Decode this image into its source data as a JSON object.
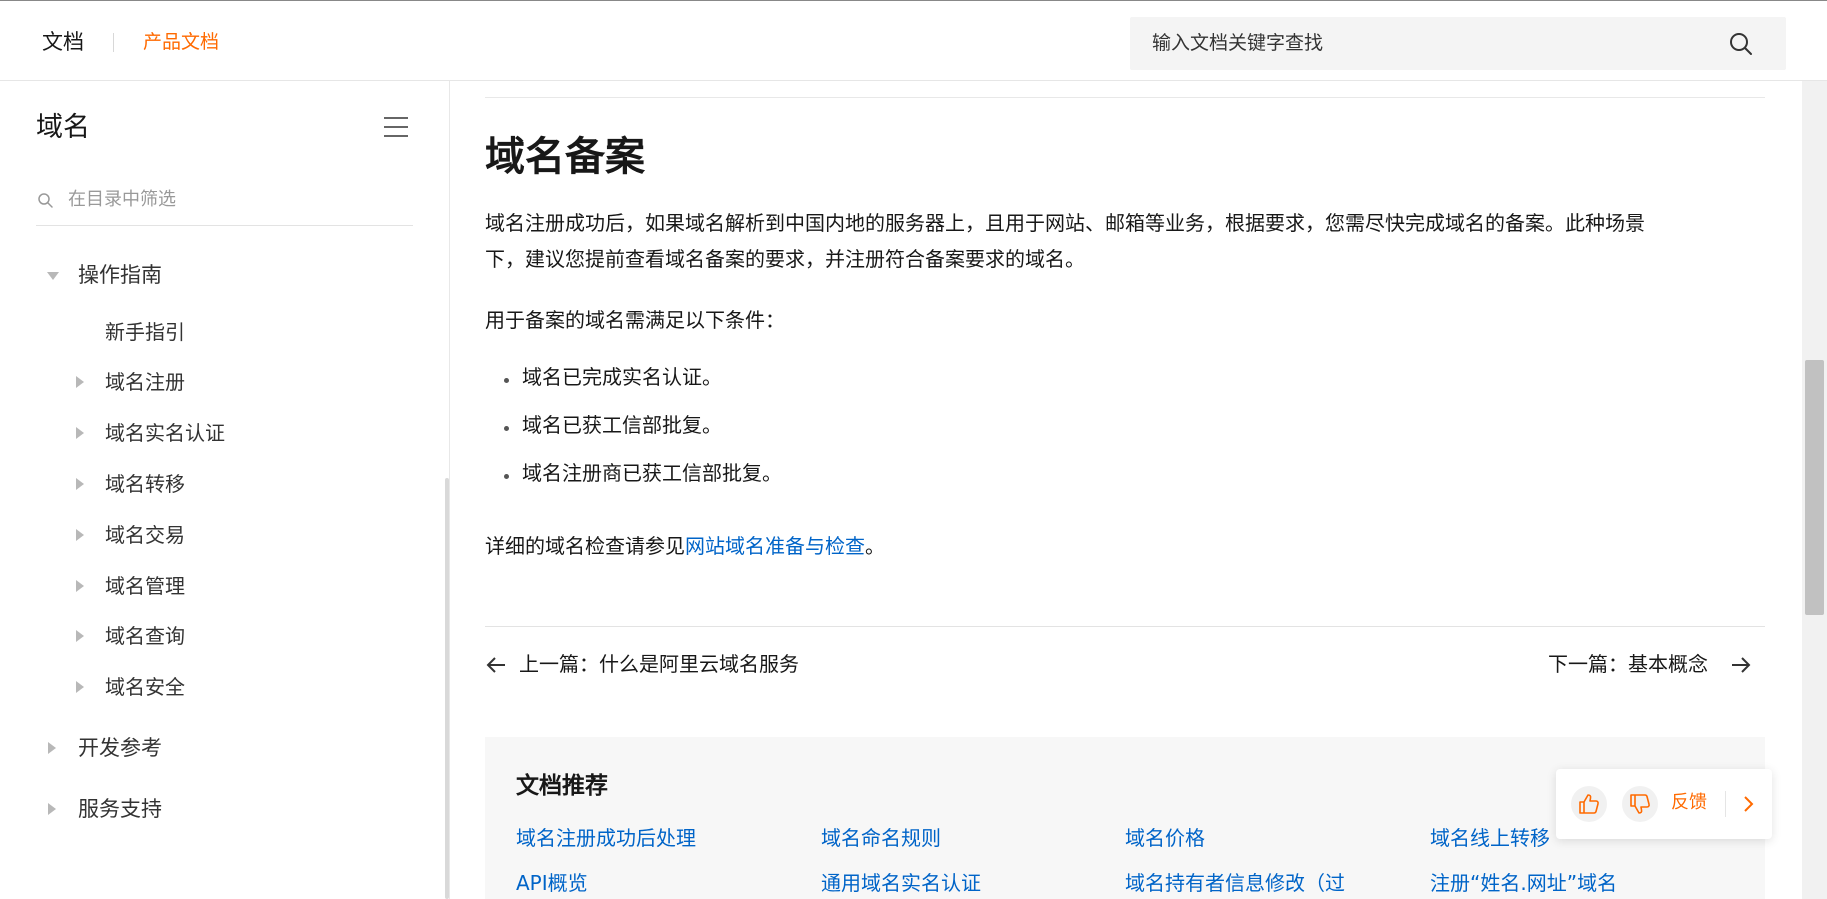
{
  "header": {
    "brand": "文档",
    "crumb": "产品文档",
    "search_placeholder": "输入文档关键字查找"
  },
  "sidebar": {
    "title": "域名",
    "filter_placeholder": "在目录中筛选",
    "groups": [
      {
        "label": "操作指南",
        "expanded": true,
        "children": [
          "新手指引",
          "域名注册",
          "域名实名认证",
          "域名转移",
          "域名交易",
          "域名管理",
          "域名查询",
          "域名安全"
        ]
      },
      {
        "label": "开发参考",
        "expanded": false
      },
      {
        "label": "服务支持",
        "expanded": false
      }
    ]
  },
  "article": {
    "title": "域名备案",
    "intro_line1": "域名注册成功后，如果域名解析到中国内地的服务器上，且用于网站、邮箱等业务，根据要求，您需尽快完成域名的备案。此种场景",
    "intro_line2": "下，建议您提前查看域名备案的要求，并注册符合备案要求的域名。",
    "conditions_lead": "用于备案的域名需满足以下条件：",
    "conditions": [
      "域名已完成实名认证。",
      "域名已获工信部批复。",
      "域名注册商已获工信部批复。"
    ],
    "detail_prefix": "详细的域名检查请参见",
    "detail_link": "网站域名准备与检查",
    "detail_suffix": "。"
  },
  "pagination": {
    "prev": "上一篇：什么是阿里云域名服务",
    "next": "下一篇：基本概念"
  },
  "recommend": {
    "title": "文档推荐",
    "row1": [
      "域名注册成功后处理",
      "域名命名规则",
      "域名价格",
      "域名线上转移"
    ],
    "row2": [
      "API概览",
      "通用域名实名认证",
      "域名持有者信息修改（过",
      "注册“姓名.网址”域名"
    ]
  },
  "feedback": {
    "label": "反馈",
    "icons": [
      "thumbs-up-icon",
      "thumbs-down-icon",
      "chevron-right-icon"
    ]
  },
  "colors": {
    "accent": "#ff6a00",
    "link": "#0064c8"
  }
}
